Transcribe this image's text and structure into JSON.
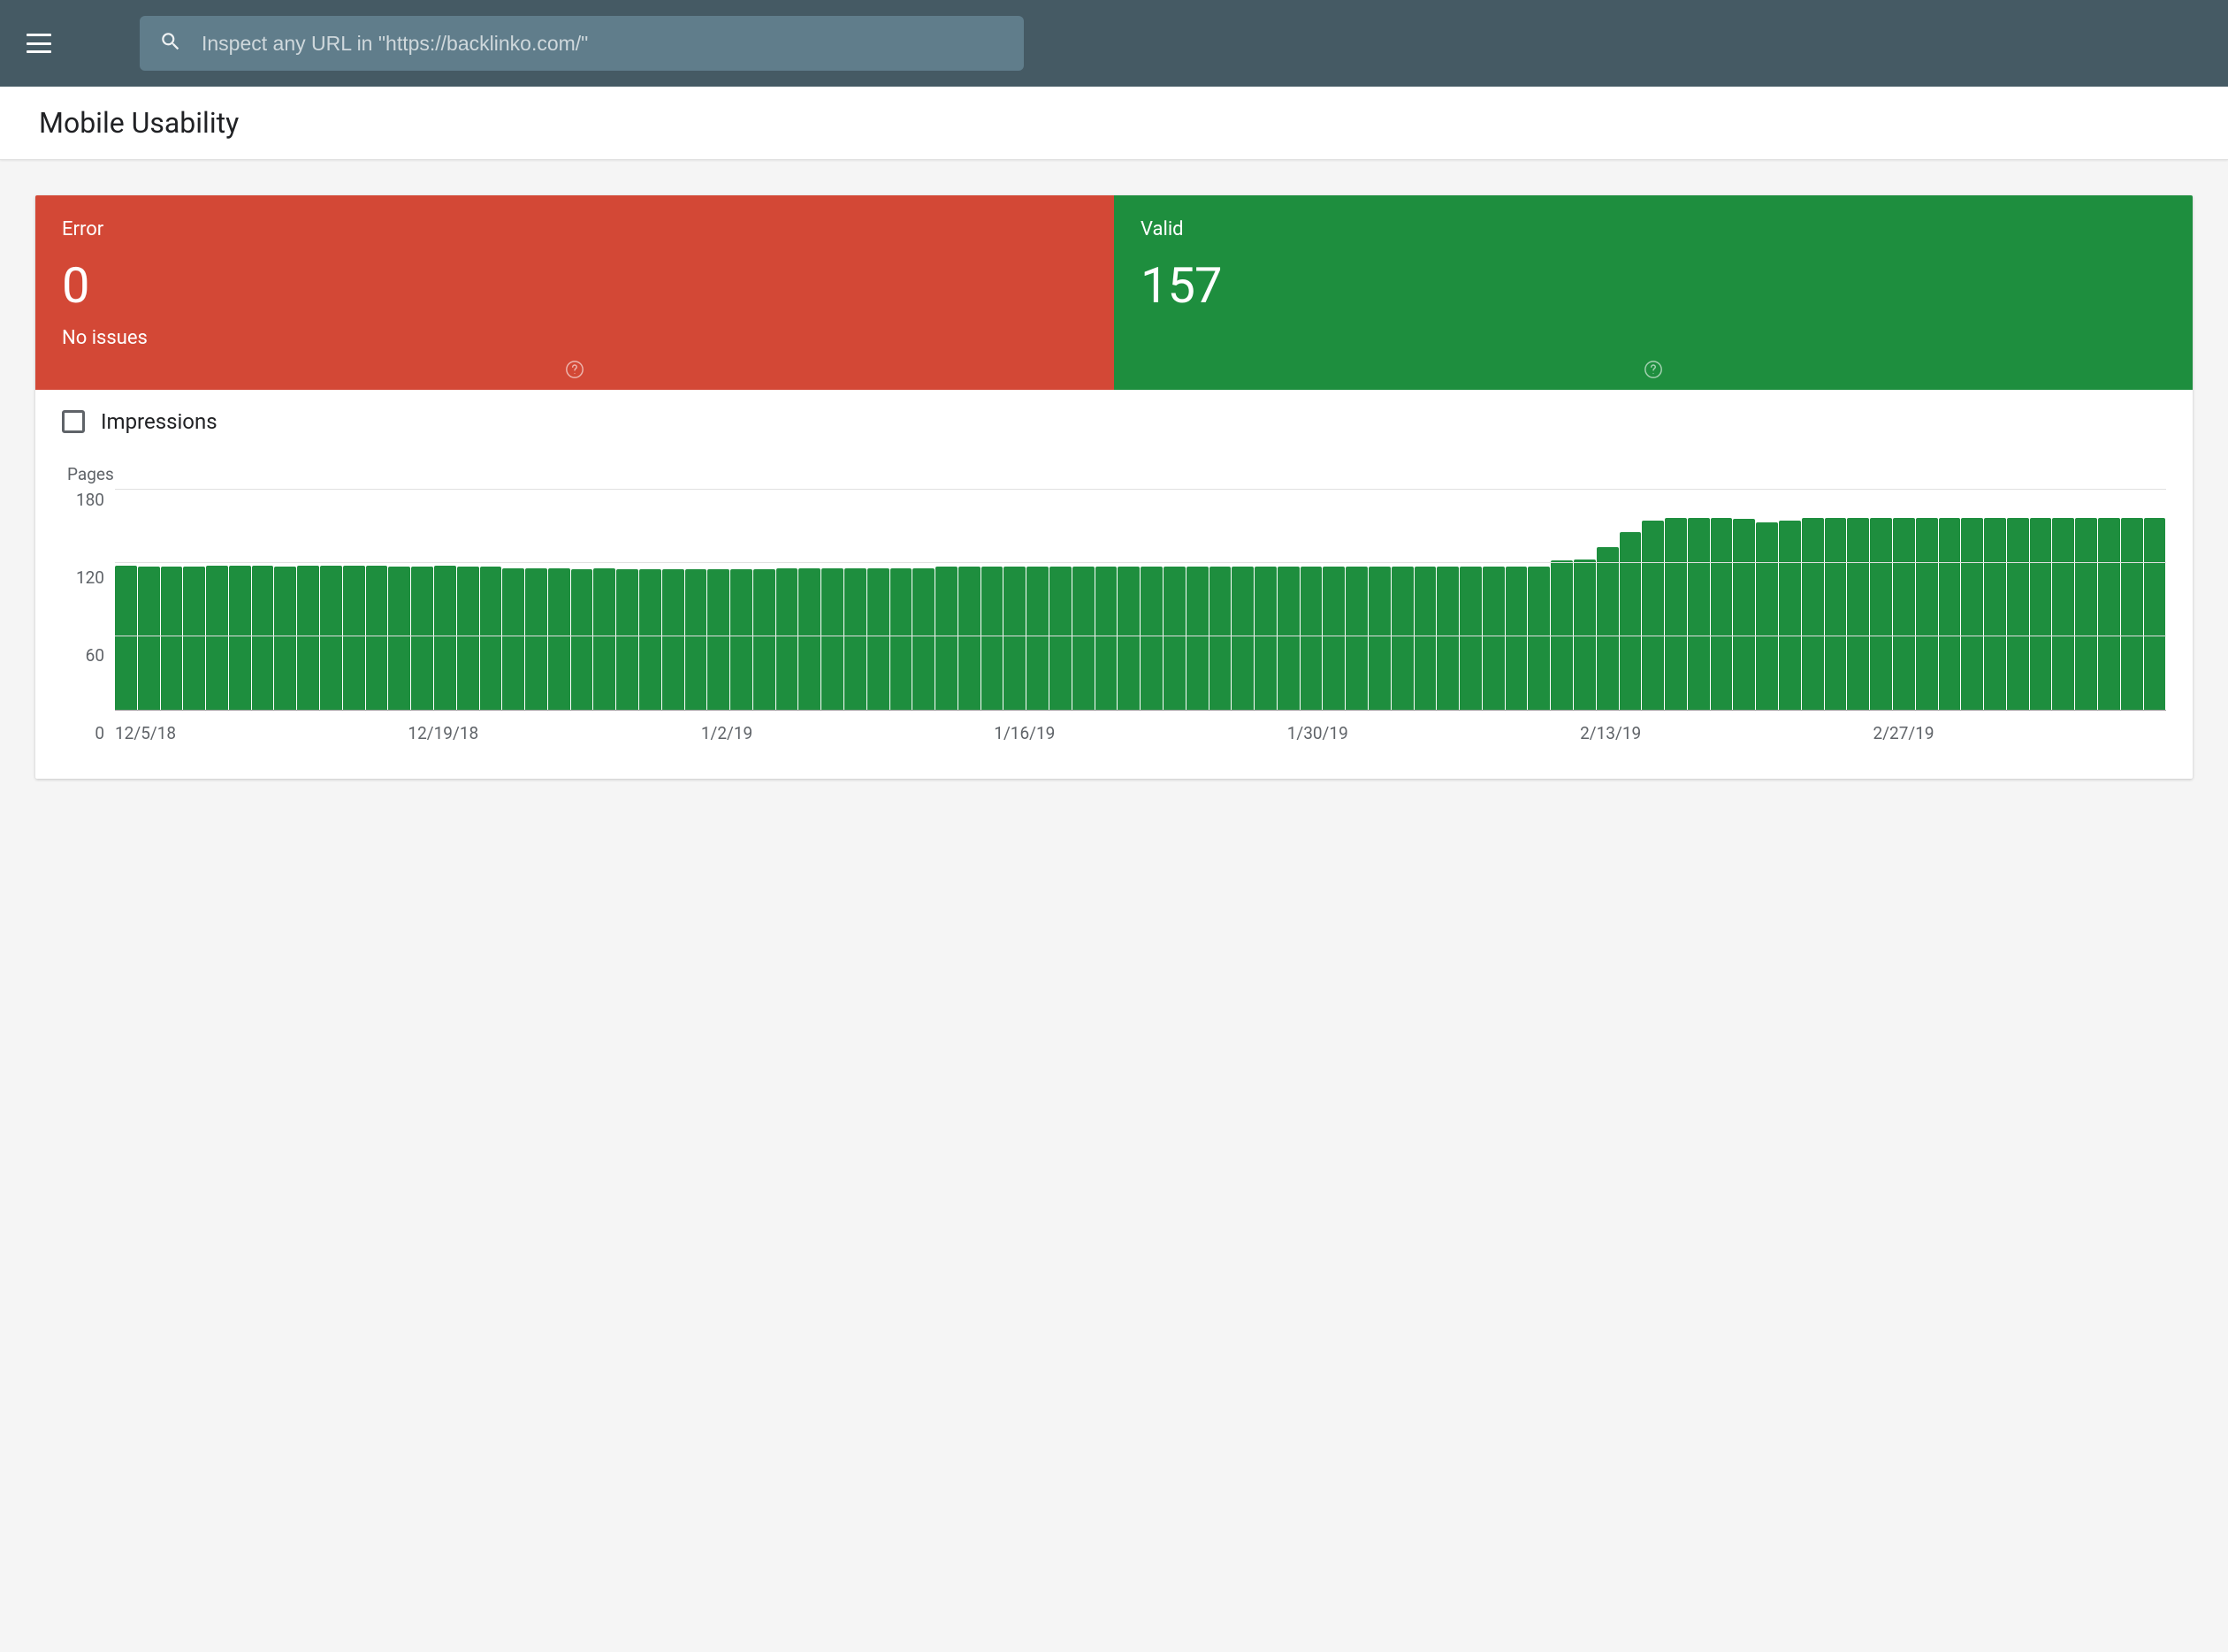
{
  "search": {
    "placeholder": "Inspect any URL in \"https://backlinko.com/\""
  },
  "page": {
    "title": "Mobile Usability"
  },
  "stats": {
    "error": {
      "label": "Error",
      "value": "0",
      "sub": "No issues"
    },
    "valid": {
      "label": "Valid",
      "value": "157"
    }
  },
  "impressions": {
    "label": "Impressions",
    "checked": false
  },
  "colors": {
    "error": "#d34836",
    "valid": "#1e8e3e",
    "topbar": "#455a64"
  },
  "chart_data": {
    "type": "bar",
    "title": "",
    "xlabel": "",
    "ylabel": "Pages",
    "ylim": [
      0,
      180
    ],
    "yticks": [
      0,
      60,
      120,
      180
    ],
    "xticks": [
      "12/5/18",
      "12/19/18",
      "1/2/19",
      "1/16/19",
      "1/30/19",
      "2/13/19",
      "2/27/19"
    ],
    "categories": [
      "12/5/18",
      "12/6/18",
      "12/7/18",
      "12/8/18",
      "12/9/18",
      "12/10/18",
      "12/11/18",
      "12/12/18",
      "12/13/18",
      "12/14/18",
      "12/15/18",
      "12/16/18",
      "12/17/18",
      "12/18/18",
      "12/19/18",
      "12/20/18",
      "12/21/18",
      "12/22/18",
      "12/23/18",
      "12/24/18",
      "12/25/18",
      "12/26/18",
      "12/27/18",
      "12/28/18",
      "12/29/18",
      "12/30/18",
      "12/31/18",
      "1/1/19",
      "1/2/19",
      "1/3/19",
      "1/4/19",
      "1/5/19",
      "1/6/19",
      "1/7/19",
      "1/8/19",
      "1/9/19",
      "1/10/19",
      "1/11/19",
      "1/12/19",
      "1/13/19",
      "1/14/19",
      "1/15/19",
      "1/16/19",
      "1/17/19",
      "1/18/19",
      "1/19/19",
      "1/20/19",
      "1/21/19",
      "1/22/19",
      "1/23/19",
      "1/24/19",
      "1/25/19",
      "1/26/19",
      "1/27/19",
      "1/28/19",
      "1/29/19",
      "1/30/19",
      "1/31/19",
      "2/1/19",
      "2/2/19",
      "2/3/19",
      "2/4/19",
      "2/5/19",
      "2/6/19",
      "2/7/19",
      "2/8/19",
      "2/9/19",
      "2/10/19",
      "2/11/19",
      "2/12/19",
      "2/13/19",
      "2/14/19",
      "2/15/19",
      "2/16/19",
      "2/17/19",
      "2/18/19",
      "2/19/19",
      "2/20/19",
      "2/21/19",
      "2/22/19",
      "2/23/19",
      "2/24/19",
      "2/25/19",
      "2/26/19",
      "2/27/19",
      "2/28/19",
      "3/1/19",
      "3/2/19",
      "3/3/19",
      "3/4/19"
    ],
    "values": [
      118,
      117,
      117,
      117,
      118,
      118,
      118,
      117,
      118,
      118,
      118,
      118,
      117,
      117,
      118,
      117,
      117,
      116,
      116,
      116,
      115,
      116,
      115,
      115,
      115,
      115,
      115,
      115,
      115,
      116,
      116,
      116,
      116,
      116,
      116,
      116,
      117,
      117,
      117,
      117,
      117,
      117,
      117,
      117,
      117,
      117,
      117,
      117,
      117,
      117,
      117,
      117,
      117,
      117,
      117,
      117,
      117,
      117,
      117,
      117,
      117,
      117,
      117,
      122,
      123,
      133,
      145,
      155,
      157,
      157,
      157,
      156,
      153,
      155,
      157,
      157,
      157,
      157,
      157,
      157,
      157,
      157,
      157,
      157,
      157,
      157,
      157,
      157,
      157,
      157
    ]
  }
}
